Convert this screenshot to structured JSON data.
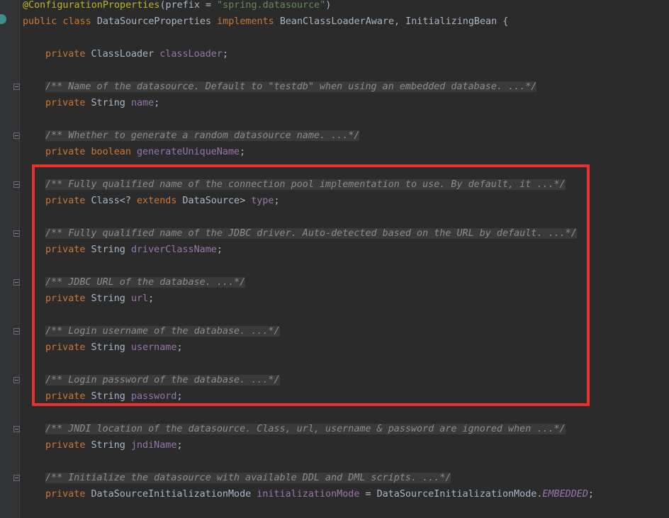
{
  "editor": {
    "annotation": {
      "name": "@ConfigurationProperties",
      "param": "prefix",
      "eq": " = ",
      "value": "\"spring.datasource\"",
      "close": ")"
    },
    "class_decl": {
      "modifiers": "public class",
      "name": "DataSourceProperties",
      "implements": "implements",
      "interfaces": "BeanClassLoaderAware, InitializingBean {"
    },
    "members": [
      {
        "modifier": "private",
        "type": "ClassLoader",
        "name": "classLoader"
      },
      {
        "doc": "/** Name of the datasource. Default to \"testdb\" when using an embedded database. ...*/",
        "modifier": "private",
        "type": "String",
        "name": "name"
      },
      {
        "doc": "/** Whether to generate a random datasource name. ...*/",
        "modifier": "private",
        "type": "boolean",
        "name": "generateUniqueName"
      },
      {
        "doc": "/** Fully qualified name of the connection pool implementation to use. By default, it ...*/",
        "modifier": "private",
        "type_pre": "Class<? ",
        "type_kw": "extends",
        "type_post": " DataSource>",
        "name": "type"
      },
      {
        "doc": "/** Fully qualified name of the JDBC driver. Auto-detected based on the URL by default. ...*/",
        "modifier": "private",
        "type": "String",
        "name": "driverClassName"
      },
      {
        "doc": "/** JDBC URL of the database. ...*/",
        "modifier": "private",
        "type": "String",
        "name": "url"
      },
      {
        "doc": "/** Login username of the database. ...*/",
        "modifier": "private",
        "type": "String",
        "name": "username"
      },
      {
        "doc": "/** Login password of the database. ...*/",
        "modifier": "private",
        "type": "String",
        "name": "password"
      },
      {
        "doc": "/** JNDI location of the datasource. Class, url, username & password are ignored when ...*/",
        "modifier": "private",
        "type": "String",
        "name": "jndiName"
      },
      {
        "doc": "/** Initialize the datasource with available DDL and DML scripts. ...*/",
        "modifier": "private",
        "type": "DataSourceInitializationMode",
        "name": "initializationMode",
        "init_eq": " = ",
        "init_cls": "DataSourceInitializationMode.",
        "init_const": "EMBEDDED",
        "init_end": ";"
      }
    ]
  },
  "colors": {
    "background": "#2b2b2b",
    "keyword": "#cc7832",
    "annotation": "#bbb529",
    "string": "#6a8759",
    "field": "#9876aa",
    "doc_comment": "#8c8c8c",
    "highlight_box": "#e8302f"
  }
}
